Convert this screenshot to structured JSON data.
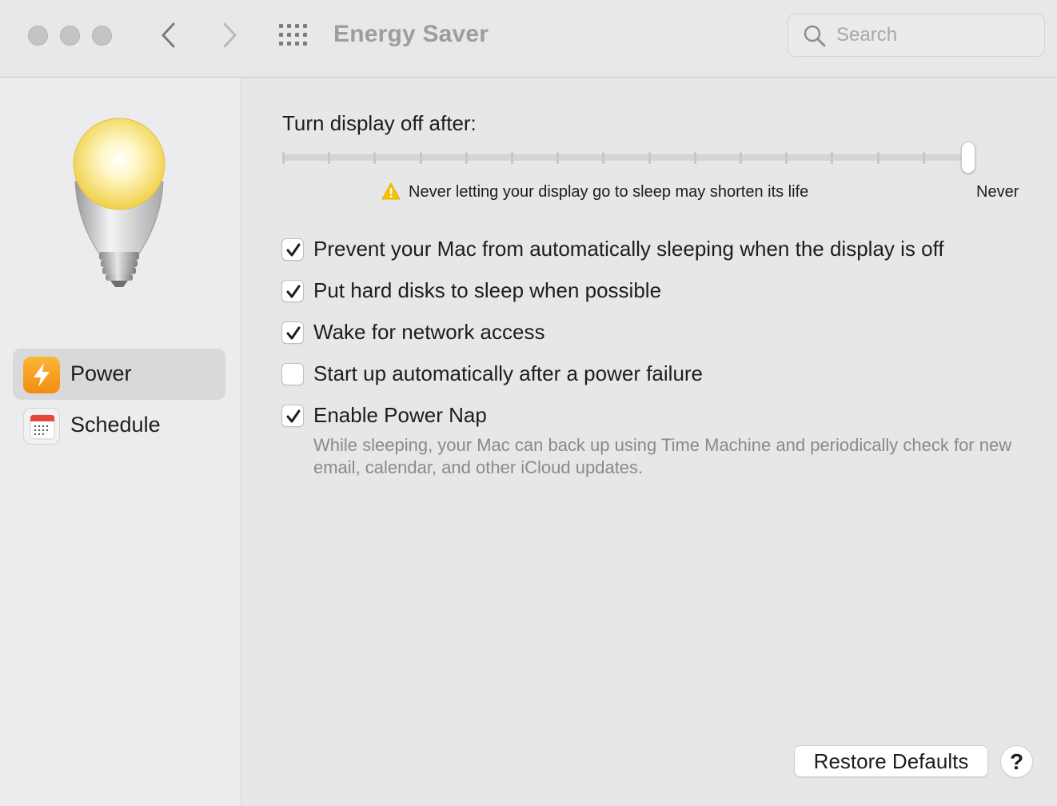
{
  "window": {
    "title": "Energy Saver",
    "search_placeholder": "Search"
  },
  "sidebar": {
    "items": [
      {
        "label": "Power",
        "icon": "power-bolt-icon",
        "selected": true,
        "accent": "#f7a21b"
      },
      {
        "label": "Schedule",
        "icon": "calendar-icon",
        "selected": false,
        "accent": "#e8463a"
      }
    ]
  },
  "display_sleep": {
    "label": "Turn display off after:",
    "slider_value": "Never",
    "slider_fraction": 1.0,
    "tick_count": 16,
    "warning": "Never letting your display go to sleep may shorten its life",
    "end_label": "Never"
  },
  "options": [
    {
      "label": "Prevent your Mac from automatically sleeping when the display is off",
      "checked": true
    },
    {
      "label": "Put hard disks to sleep when possible",
      "checked": true
    },
    {
      "label": "Wake for network access",
      "checked": true
    },
    {
      "label": "Start up automatically after a power failure",
      "checked": false
    },
    {
      "label": "Enable Power Nap",
      "checked": true
    }
  ],
  "power_nap_description": "While sleeping, your Mac can back up using Time Machine and periodically check for new email, calendar, and other iCloud updates.",
  "footer": {
    "restore_label": "Restore Defaults",
    "help_label": "?"
  },
  "colors": {
    "warning": "#f5c400",
    "checkmark": "#1d1d1f"
  }
}
